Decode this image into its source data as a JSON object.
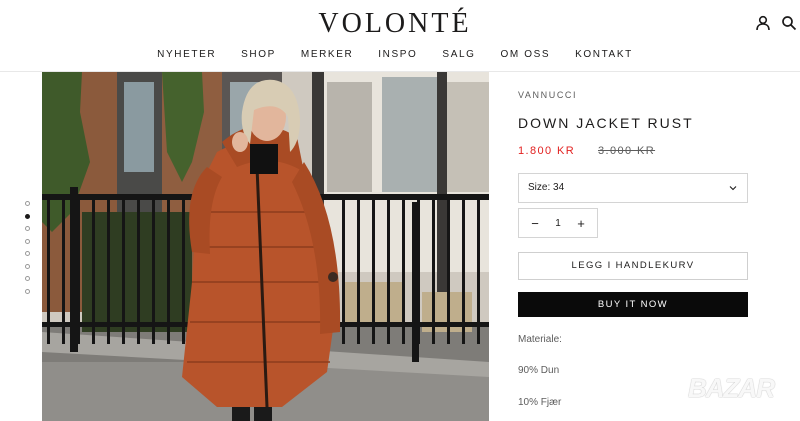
{
  "header": {
    "logo": "VOLONTÉ",
    "nav": [
      "NYHETER",
      "SHOP",
      "MERKER",
      "INSPO",
      "SALG",
      "OM OSS",
      "KONTAKT"
    ],
    "account_icon": "user-icon",
    "search_icon": "search-icon"
  },
  "gallery": {
    "dot_count": 8,
    "active_dot": 2
  },
  "product": {
    "brand": "VANNUCCI",
    "title": "DOWN JACKET RUST",
    "price": "1.800 KR",
    "old_price": "3.000 KR",
    "size_select": "Size: 34",
    "quantity": "1",
    "qty_minus": "−",
    "qty_plus": "+",
    "add_to_cart": "LEGG I HANDLEKURV",
    "buy_now": "BUY IT NOW",
    "material_label": "Materiale:",
    "material_1": "90% Dun",
    "material_2": "10% Fjær"
  },
  "watermark": "BAZAR",
  "colors": {
    "sale_price": "#e22120",
    "jacket": "#b8542b",
    "buy_button": "#0a0a0a"
  }
}
